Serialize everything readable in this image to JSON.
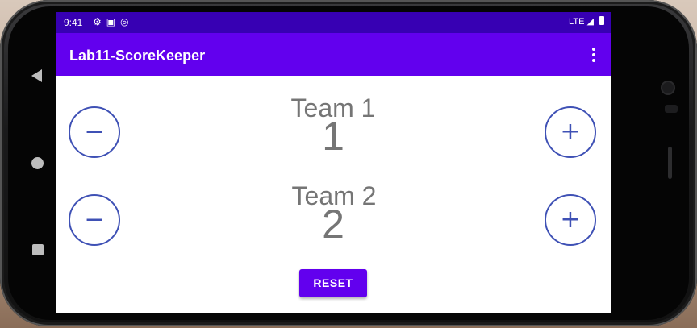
{
  "status_bar": {
    "time": "9:41",
    "network": "LTE",
    "icons": [
      "settings-icon",
      "a-icon",
      "sync-icon",
      "signal-icon",
      "battery-icon"
    ]
  },
  "app_bar": {
    "title": "Lab11-ScoreKeeper",
    "menu_icon": "overflow-menu-icon"
  },
  "teams": [
    {
      "name": "Team 1",
      "score": "1",
      "minus_label": "−",
      "plus_label": "+"
    },
    {
      "name": "Team 2",
      "score": "2",
      "minus_label": "−",
      "plus_label": "+"
    }
  ],
  "reset_label": "RESET",
  "colors": {
    "status_bar": "#3700b3",
    "app_bar": "#6200ee",
    "button_outline": "#3f51b5",
    "text_gray": "#757575"
  }
}
